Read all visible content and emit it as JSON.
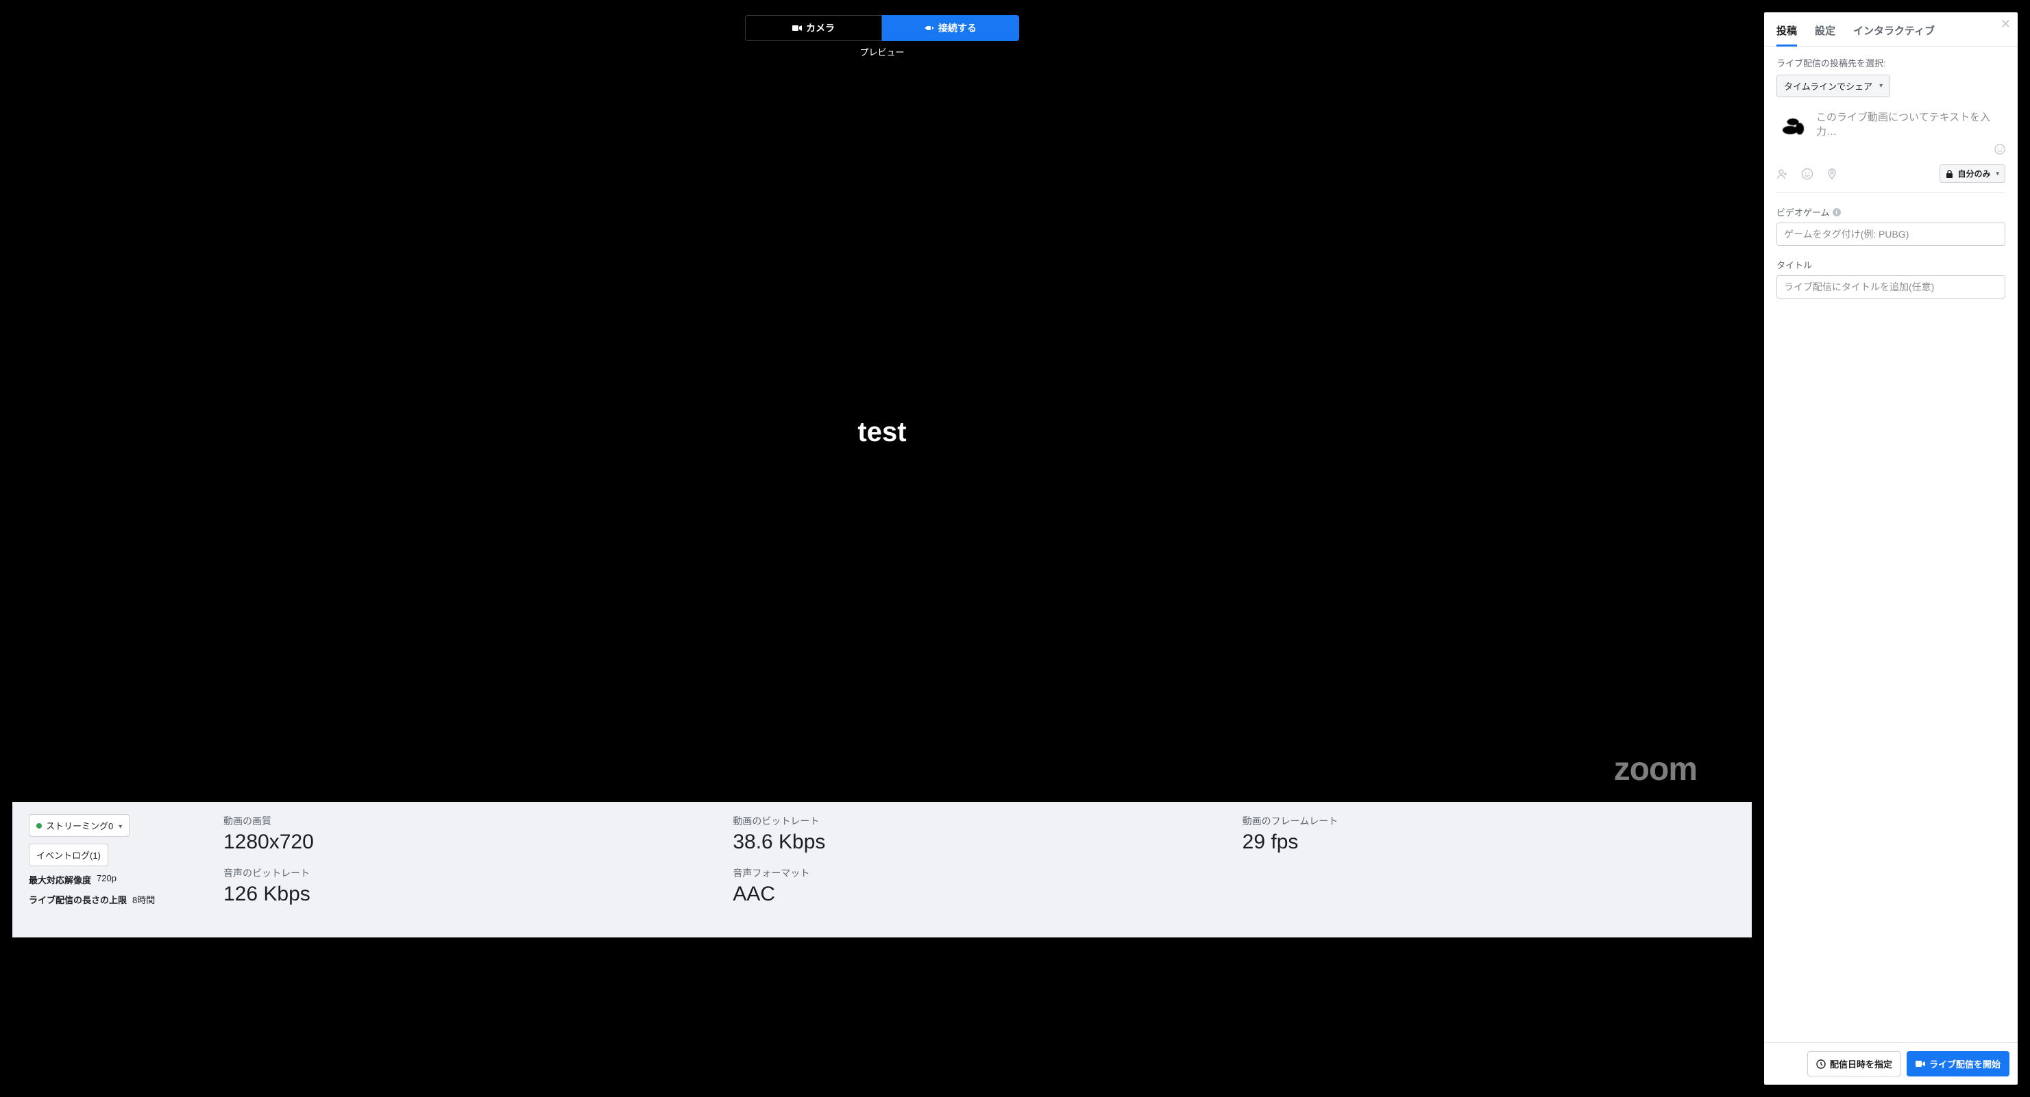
{
  "main": {
    "tabs": {
      "camera": "カメラ",
      "connect": "接続する",
      "active_caption": "プレビュー"
    },
    "video_overlay_text": "test",
    "watermark": "zoom"
  },
  "stats": {
    "streaming_chip": "ストリーミング0",
    "event_log_chip": "イベントログ(1)",
    "max_res_label": "最大対応解像度",
    "max_res_value": "720p",
    "max_len_label": "ライブ配信の長さの上限",
    "max_len_value": "8時間",
    "blocks": {
      "vq_label": "動画の画質",
      "vq_value": "1280x720",
      "vbr_label": "動画のビットレート",
      "vbr_value": "38.6 Kbps",
      "vfr_label": "動画のフレームレート",
      "vfr_value": "29 fps",
      "abr_label": "音声のビットレート",
      "abr_value": "126 Kbps",
      "af_label": "音声フォーマット",
      "af_value": "AAC"
    }
  },
  "sidebar": {
    "tabs": {
      "post": "投稿",
      "settings": "設定",
      "interactive": "インタラクティブ"
    },
    "select_dest_label": "ライブ配信の投稿先を選択:",
    "dest_dropdown": "タイムラインでシェア",
    "composer_placeholder": "このライブ動画についてテキストを入力…",
    "privacy": "自分のみ",
    "video_game_label": "ビデオゲーム",
    "video_game_placeholder": "ゲームをタグ付け(例: PUBG)",
    "title_label": "タイトル",
    "title_placeholder": "ライブ配信にタイトルを追加(任意)",
    "footer": {
      "schedule": "配信日時を指定",
      "go_live": "ライブ配信を開始"
    }
  }
}
